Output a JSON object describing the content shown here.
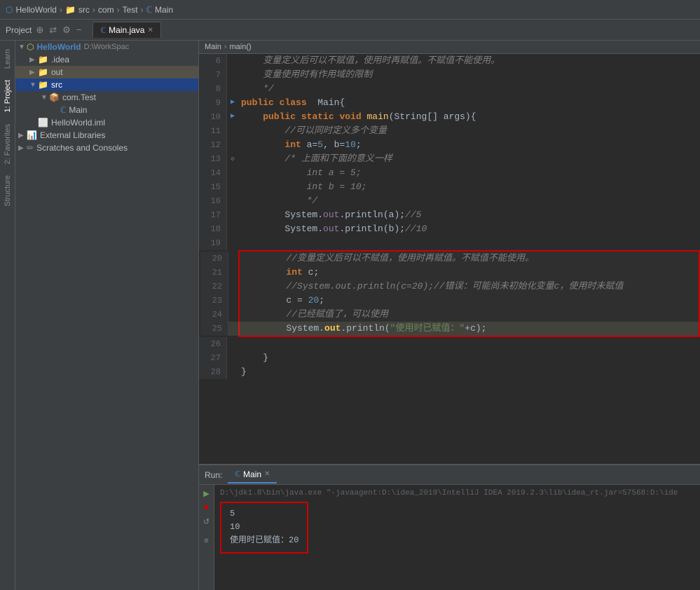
{
  "titlebar": {
    "parts": [
      "HelloWorld",
      "src",
      "com",
      "Test",
      "Main"
    ],
    "separators": [
      ">",
      ">",
      ">",
      ">"
    ]
  },
  "tabs": [
    {
      "label": "Main.java",
      "active": true,
      "icon": "java"
    }
  ],
  "toolbar": {
    "icons": [
      "folder-open",
      "sync",
      "settings",
      "minus"
    ]
  },
  "sidebar": {
    "header": "Project",
    "tree": [
      {
        "id": "helloworld",
        "label": "HelloWorld",
        "path": "D:\\WorkSpac",
        "indent": 0,
        "type": "project",
        "expanded": true
      },
      {
        "id": "idea",
        "label": ".idea",
        "indent": 1,
        "type": "folder",
        "expanded": false
      },
      {
        "id": "out",
        "label": "out",
        "indent": 1,
        "type": "folder",
        "expanded": false,
        "highlighted": true
      },
      {
        "id": "src",
        "label": "src",
        "indent": 1,
        "type": "folder",
        "expanded": true,
        "selected": true
      },
      {
        "id": "com.test",
        "label": "com.Test",
        "indent": 2,
        "type": "package",
        "expanded": true
      },
      {
        "id": "main",
        "label": "Main",
        "indent": 3,
        "type": "java",
        "expanded": false
      },
      {
        "id": "helloworld-iml",
        "label": "HelloWorld.iml",
        "indent": 1,
        "type": "iml"
      },
      {
        "id": "external-libs",
        "label": "External Libraries",
        "indent": 0,
        "type": "libs",
        "expanded": false
      },
      {
        "id": "scratches",
        "label": "Scratches and Consoles",
        "indent": 0,
        "type": "scratch",
        "expanded": false
      }
    ]
  },
  "editor": {
    "breadcrumb": [
      "Main",
      "main()"
    ],
    "lines": [
      {
        "num": 6,
        "arrow": "",
        "content": "    变量定义后可以不赋值，使用时再赋值。不赋值不能使用。",
        "type": "comment-cn"
      },
      {
        "num": 7,
        "arrow": "",
        "content": "    变量使用时有作用域的限制",
        "type": "comment-cn"
      },
      {
        "num": 8,
        "arrow": "",
        "content": "    */",
        "type": "comment"
      },
      {
        "num": 9,
        "arrow": "▶",
        "content": "public class Main{",
        "type": "code",
        "highlight_arrow": true
      },
      {
        "num": 10,
        "arrow": "▶",
        "content": "    public static void main(String[] args){",
        "type": "code"
      },
      {
        "num": 11,
        "arrow": "",
        "content": "        //可以同时定义多个变量",
        "type": "comment-cn"
      },
      {
        "num": 12,
        "arrow": "",
        "content": "        int a=5, b=10;",
        "type": "code"
      },
      {
        "num": 13,
        "arrow": "◇",
        "content": "        /* 上面和下面的意义一样",
        "type": "comment"
      },
      {
        "num": 14,
        "arrow": "",
        "content": "            int a = 5;",
        "type": "comment"
      },
      {
        "num": 15,
        "arrow": "",
        "content": "            int b = 10;",
        "type": "comment"
      },
      {
        "num": 16,
        "arrow": "",
        "content": "            */",
        "type": "comment"
      },
      {
        "num": 17,
        "arrow": "",
        "content": "        System.out.println(a);//5",
        "type": "code"
      },
      {
        "num": 18,
        "arrow": "",
        "content": "        System.out.println(b);//10",
        "type": "code"
      },
      {
        "num": 19,
        "arrow": "",
        "content": "",
        "type": "blank"
      },
      {
        "num": 20,
        "arrow": "",
        "content": "        //变量定义后可以不赋值，使用时再赋值。不赋值不能使用。",
        "type": "comment-cn",
        "boxstart": true
      },
      {
        "num": 21,
        "arrow": "",
        "content": "        int c;",
        "type": "code"
      },
      {
        "num": 22,
        "arrow": "",
        "content": "        //System.out.println(c=20);//错误：可能尚未初始化变量c，使用时未赋值",
        "type": "comment"
      },
      {
        "num": 23,
        "arrow": "",
        "content": "        c = 20;",
        "type": "code"
      },
      {
        "num": 24,
        "arrow": "",
        "content": "        //已经赋值了，可以使用",
        "type": "comment-cn"
      },
      {
        "num": 25,
        "arrow": "",
        "content": "        System.out.println(\"使用时已赋值：\"+c);",
        "type": "code-highlight",
        "boxend": true
      },
      {
        "num": 26,
        "arrow": "",
        "content": "",
        "type": "blank"
      },
      {
        "num": 27,
        "arrow": "",
        "content": "    }",
        "type": "code"
      },
      {
        "num": 28,
        "arrow": "",
        "content": "}",
        "type": "code"
      }
    ]
  },
  "run_panel": {
    "tab_label": "Main",
    "command": "D:\\jdk1.8\\bin\\java.exe \"-javaagent:D:\\idea_2019\\IntelliJ IDEA 2019.2.3\\lib\\idea_rt.jar=57568:D:\\ide",
    "output": [
      "5",
      "10",
      "使用时已赋值：20"
    ]
  },
  "left_tabs": [
    "Learn",
    "1: Project",
    "2: Favorites",
    "Structure"
  ]
}
